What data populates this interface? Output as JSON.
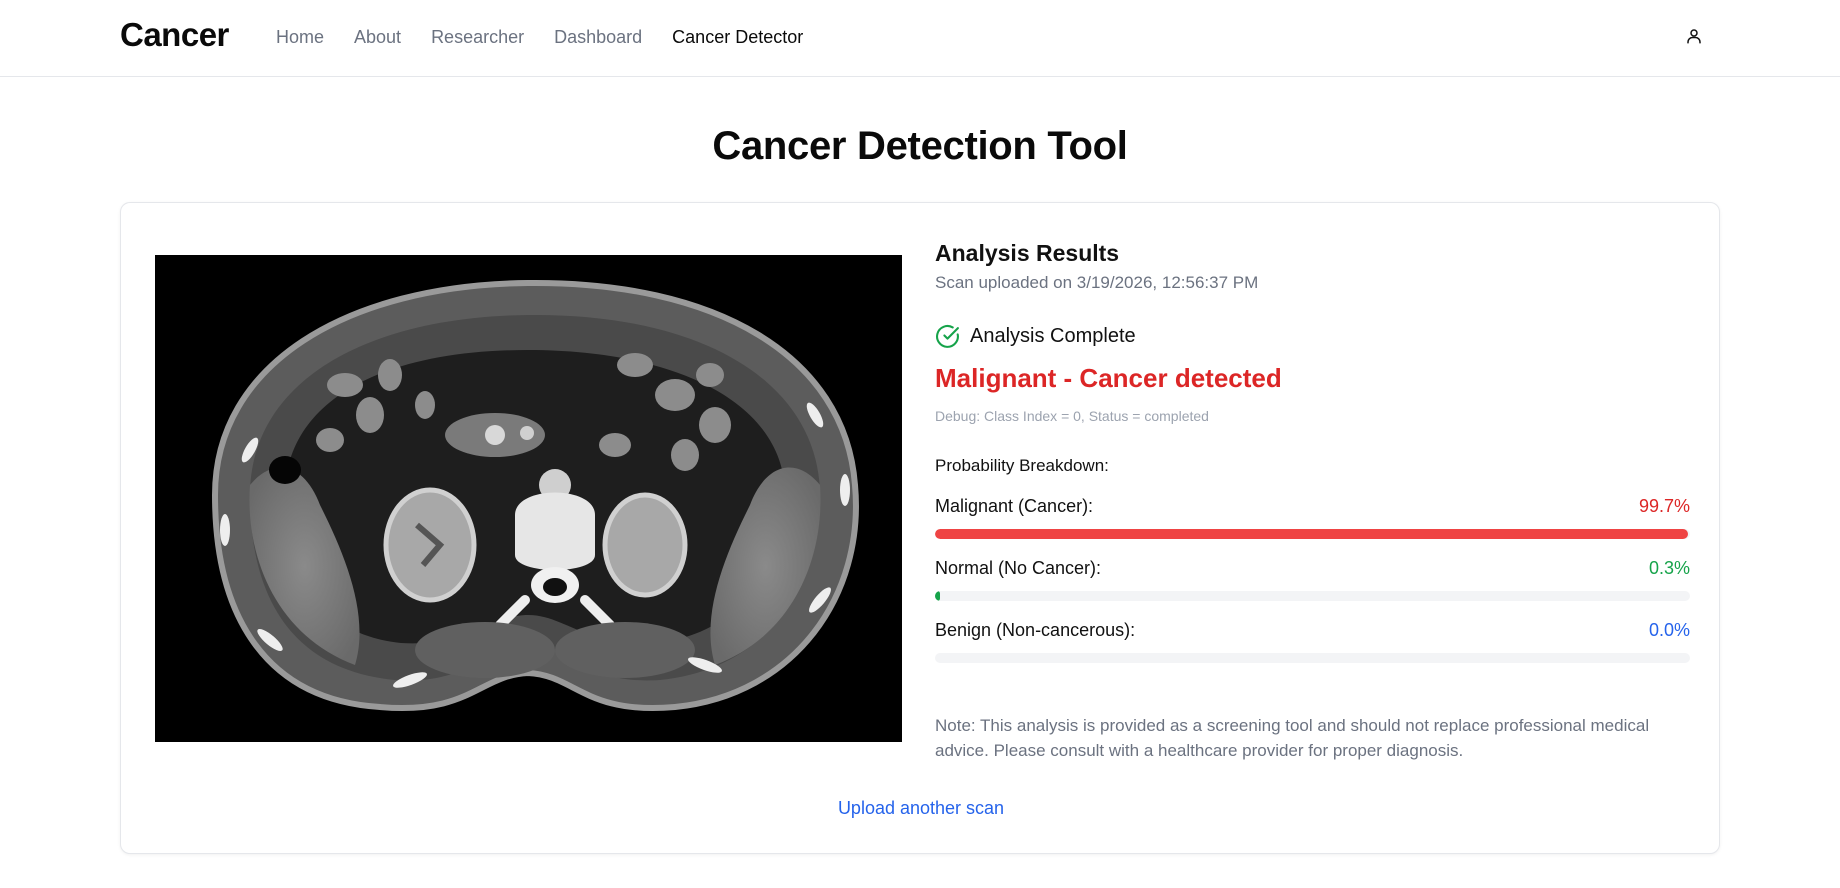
{
  "header": {
    "brand": "Cancer",
    "nav": [
      {
        "label": "Home"
      },
      {
        "label": "About"
      },
      {
        "label": "Researcher"
      },
      {
        "label": "Dashboard"
      },
      {
        "label": "Cancer Detector"
      }
    ],
    "active_nav": "Cancer Detector",
    "user_icon": "user-icon"
  },
  "main": {
    "title": "Cancer Detection Tool",
    "results": {
      "title": "Analysis Results",
      "subtitle": "Scan uploaded on 3/19/2026, 12:56:37 PM",
      "status_icon": "check-circle-icon",
      "status": "Analysis Complete",
      "diagnosis": "Malignant - Cancer detected",
      "debug": "Debug: Class Index = 0, Status = completed",
      "breakdown_title": "Probability Breakdown:",
      "probabilities": [
        {
          "label": "Malignant (Cancer):",
          "value_text": "99.7%",
          "value": 99.7,
          "color": "#ef4444",
          "text_color": "#dc2626"
        },
        {
          "label": "Normal (No Cancer):",
          "value_text": "0.3%",
          "value": 0.3,
          "color": "#16a34a",
          "text_color": "#16a34a"
        },
        {
          "label": "Benign (Non-cancerous):",
          "value_text": "0.0%",
          "value": 0.0,
          "color": "#2563eb",
          "text_color": "#2563eb"
        }
      ],
      "note": "Note: This analysis is provided as a screening tool and should not replace professional medical advice. Please consult with a healthcare provider for proper diagnosis."
    },
    "upload_link": "Upload another scan"
  },
  "colors": {
    "accent_red": "#dc2626",
    "success_green": "#16a34a",
    "link_blue": "#2563eb"
  }
}
